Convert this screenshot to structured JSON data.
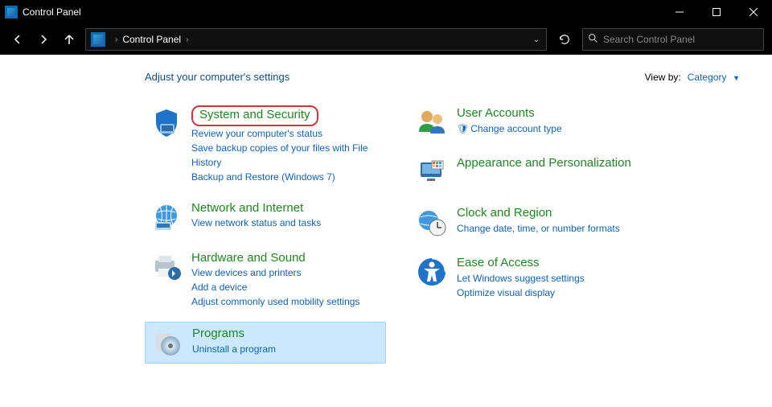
{
  "window": {
    "title": "Control Panel"
  },
  "address": {
    "root": "Control Panel"
  },
  "search": {
    "placeholder": "Search Control Panel"
  },
  "page": {
    "heading": "Adjust your computer's settings",
    "viewby_label": "View by:",
    "viewby_value": "Category"
  },
  "left": [
    {
      "title": "System and Security",
      "links": [
        "Review your computer's status",
        "Save backup copies of your files with File History",
        "Backup and Restore (Windows 7)"
      ]
    },
    {
      "title": "Network and Internet",
      "links": [
        "View network status and tasks"
      ]
    },
    {
      "title": "Hardware and Sound",
      "links": [
        "View devices and printers",
        "Add a device",
        "Adjust commonly used mobility settings"
      ]
    },
    {
      "title": "Programs",
      "links": [
        "Uninstall a program"
      ]
    }
  ],
  "right": [
    {
      "title": "User Accounts",
      "links": [
        "Change account type"
      ],
      "shield": [
        true
      ]
    },
    {
      "title": "Appearance and Personalization",
      "links": []
    },
    {
      "title": "Clock and Region",
      "links": [
        "Change date, time, or number formats"
      ]
    },
    {
      "title": "Ease of Access",
      "links": [
        "Let Windows suggest settings",
        "Optimize visual display"
      ]
    }
  ]
}
